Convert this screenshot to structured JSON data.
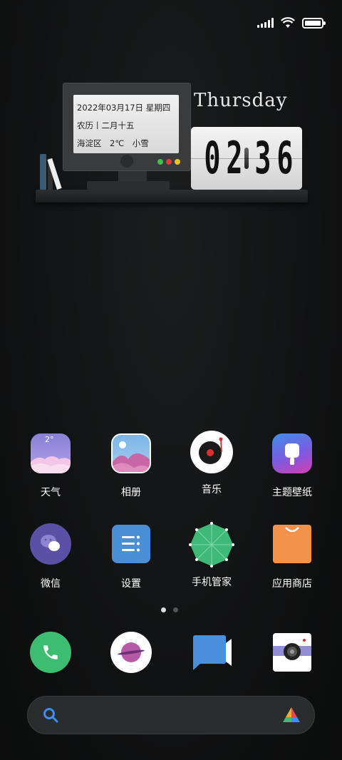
{
  "status": {
    "signal_icon": "signal-icon",
    "wifi_icon": "wifi-icon",
    "battery_icon": "battery-icon",
    "battery_level": 1.0
  },
  "widget": {
    "date_line": "2022年03月17日 星期四",
    "lunar_line": "农历丨二月十五",
    "weather_line": "海淀区　2℃　小雪",
    "day_name": "Thursday",
    "clock": {
      "d1": "0",
      "d2": "2",
      "d3": "3",
      "d4": "6"
    }
  },
  "apps": {
    "row1": [
      {
        "label": "天气",
        "icon": "weather-icon",
        "badge": "2°"
      },
      {
        "label": "相册",
        "icon": "gallery-icon"
      },
      {
        "label": "音乐",
        "icon": "music-icon"
      },
      {
        "label": "主题壁纸",
        "icon": "themes-icon"
      }
    ],
    "row2": [
      {
        "label": "微信",
        "icon": "wechat-icon"
      },
      {
        "label": "设置",
        "icon": "settings-icon"
      },
      {
        "label": "手机管家",
        "icon": "security-icon"
      },
      {
        "label": "应用商店",
        "icon": "app-store-icon"
      }
    ]
  },
  "page_indicator": {
    "pages": 2,
    "current": 1
  },
  "dock": [
    "phone-icon",
    "browser-icon",
    "messages-icon",
    "camera-icon"
  ],
  "search": {
    "search_icon": "search-icon",
    "assistant_icon": "assistant-icon"
  },
  "colors": {
    "phone": "#3dbd72",
    "music_red": "#e0302e",
    "settings": "#4a8fd6",
    "store": "#f3924a",
    "security": "#3fb978",
    "wechat": "#5b4fa6"
  }
}
